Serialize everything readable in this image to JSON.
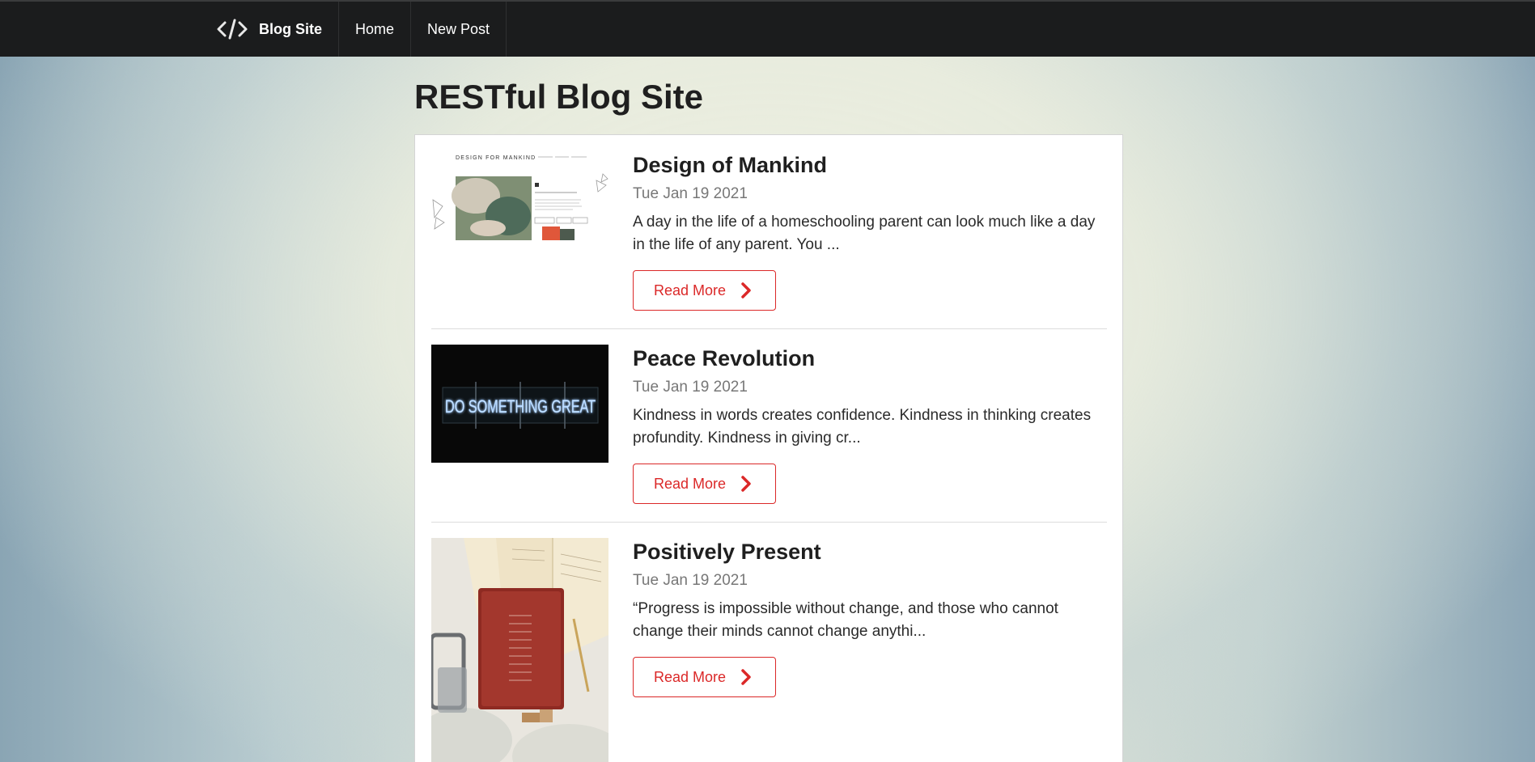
{
  "navbar": {
    "brand_label": "Blog Site",
    "brand_icon": "code-icon",
    "items": [
      {
        "label": "Home"
      },
      {
        "label": "New Post"
      }
    ],
    "background": "#1b1c1d"
  },
  "page": {
    "title": "RESTful Blog Site"
  },
  "posts": [
    {
      "title": "Design of Mankind",
      "date": "Tue Jan 19 2021",
      "excerpt": "A day in the life of a homeschooling parent can look much like a day in the life of any parent. You ...",
      "button_label": "Read More",
      "thumbnail_header": "DESIGN FOR MANKIND"
    },
    {
      "title": "Peace Revolution",
      "date": "Tue Jan 19 2021",
      "excerpt": "Kindness in words creates confidence. Kindness in thinking creates profundity. Kindness in giving cr...",
      "button_label": "Read More",
      "thumbnail_sign": "DO SOMETHING GREAT"
    },
    {
      "title": "Positively Present",
      "date": "Tue Jan 19 2021",
      "excerpt": "“Progress is impossible without change, and those who cannot change their minds cannot change anythi...",
      "button_label": "Read More"
    }
  ],
  "colors": {
    "accent": "#db2828",
    "date_text": "#777777"
  }
}
